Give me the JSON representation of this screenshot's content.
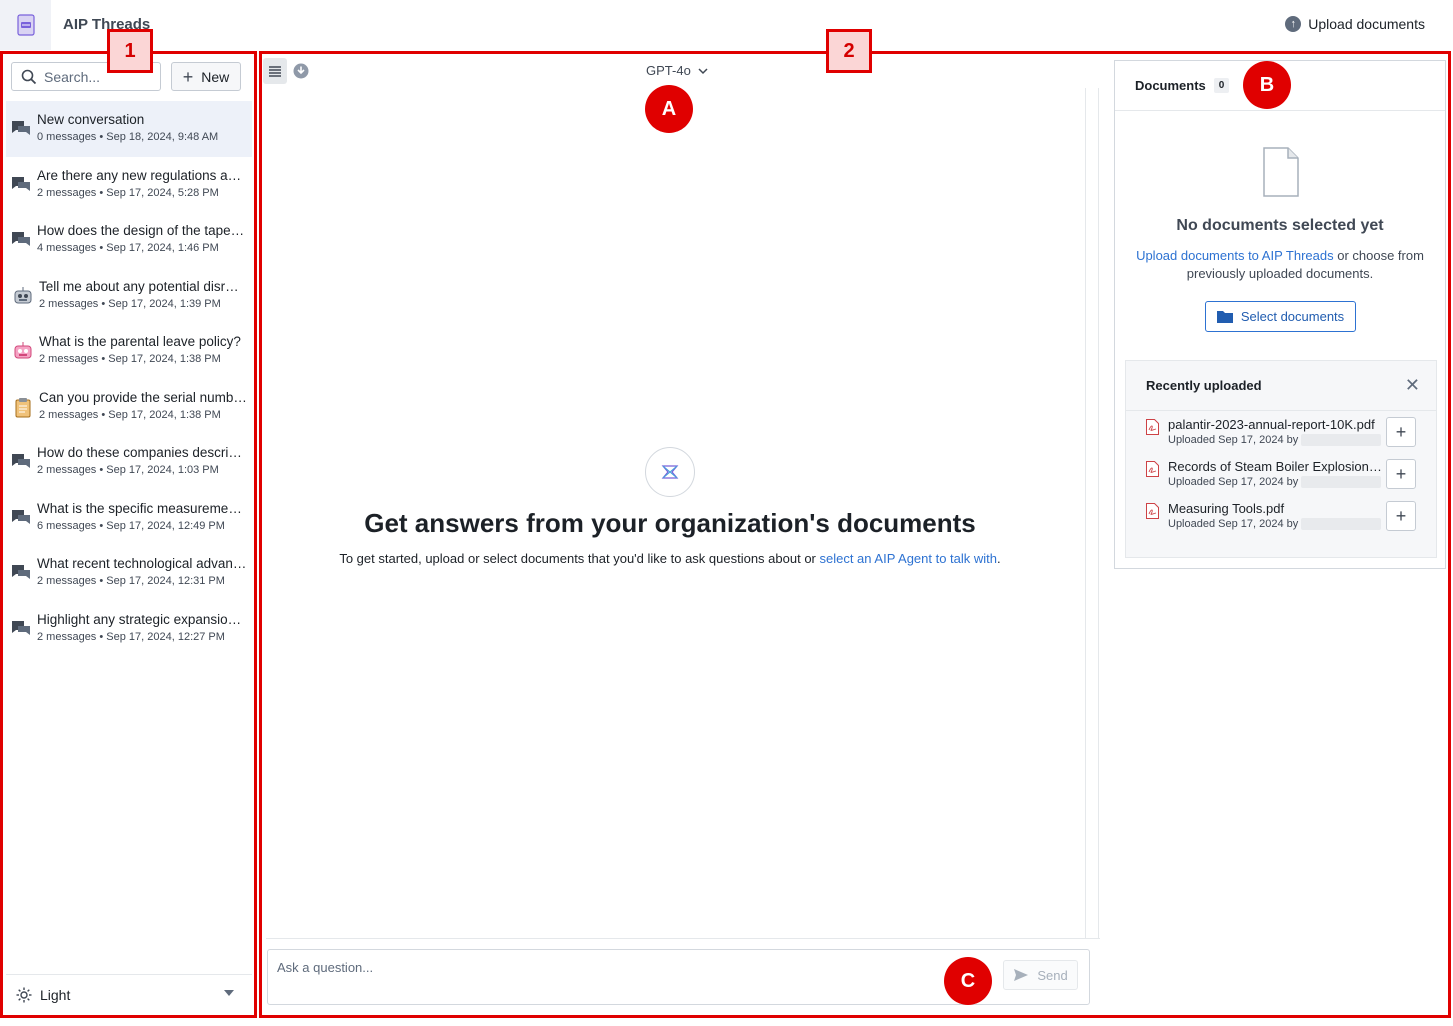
{
  "app": {
    "title": "AIP Threads",
    "upload_label": "Upload documents"
  },
  "annotations": {
    "box1": "1",
    "box2": "2",
    "circleA": "A",
    "circleB": "B",
    "circleC": "C"
  },
  "sidebar": {
    "search_placeholder": "Search...",
    "new_label": "New",
    "conversations": [
      {
        "title": "New conversation",
        "meta": "0 messages • Sep 18, 2024, 9:48 AM",
        "icon": "chat-icon"
      },
      {
        "title": "Are there any new regulations ap…",
        "meta": "2 messages • Sep 17, 2024, 5:28 PM",
        "icon": "chat-icon"
      },
      {
        "title": "How does the design of the taper …",
        "meta": "4 messages • Sep 17, 2024, 1:46 PM",
        "icon": "chat-icon"
      },
      {
        "title": "Tell me about any potential disr…",
        "meta": "2 messages • Sep 17, 2024, 1:39 PM",
        "icon": "robot-icon"
      },
      {
        "title": "What is the parental leave policy?",
        "meta": "2 messages • Sep 17, 2024, 1:38 PM",
        "icon": "pink-robot-icon"
      },
      {
        "title": "Can you provide the serial numb…",
        "meta": "2 messages • Sep 17, 2024, 1:38 PM",
        "icon": "clipboard-icon"
      },
      {
        "title": "How do these companies describ…",
        "meta": "2 messages • Sep 17, 2024, 1:03 PM",
        "icon": "chat-icon"
      },
      {
        "title": "What is the specific measuremen…",
        "meta": "6 messages • Sep 17, 2024, 12:49 PM",
        "icon": "chat-icon"
      },
      {
        "title": "What recent technological advan…",
        "meta": "2 messages • Sep 17, 2024, 12:31 PM",
        "icon": "chat-icon"
      },
      {
        "title": "Highlight any strategic expansion…",
        "meta": "2 messages • Sep 17, 2024, 12:27 PM",
        "icon": "chat-icon"
      }
    ],
    "theme_label": "Light"
  },
  "main": {
    "model_label": "GPT-4o",
    "hero_title": "Get answers from your organization's documents",
    "hero_sub_prefix": "To get started, upload or select documents that you'd like to ask questions about or ",
    "hero_sub_link": "select an AIP Agent to talk with",
    "hero_sub_suffix": ".",
    "composer_placeholder": "Ask a question...",
    "send_label": "Send"
  },
  "documents": {
    "header": "Documents",
    "count": "0",
    "empty_title": "No documents selected yet",
    "empty_link": "Upload documents to AIP Threads",
    "empty_rest": " or choose from previously uploaded documents.",
    "select_label": "Select documents",
    "recent_title": "Recently uploaded",
    "files": [
      {
        "name": "palantir-2023-annual-report-10K.pdf",
        "meta": "Uploaded Sep 17, 2024 by"
      },
      {
        "name": "Records of Steam Boiler Explosion…",
        "meta": "Uploaded Sep 17, 2024 by"
      },
      {
        "name": "Measuring Tools.pdf",
        "meta": "Uploaded Sep 17, 2024 by"
      }
    ]
  },
  "colors": {
    "annotation_red": "#e00000",
    "link_blue": "#2d72d2",
    "active_row": "#edf1f9"
  }
}
